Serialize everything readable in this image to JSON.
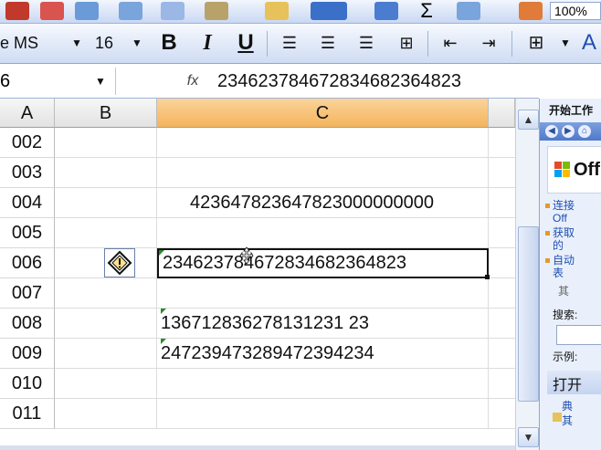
{
  "toolbar_top": {
    "zoom": "100%",
    "icons": [
      "print-icon",
      "preview-icon",
      "spell-icon",
      "research-icon",
      "copy-icon",
      "paste-icon",
      "format-painter-icon",
      "undo-icon",
      "hyperlink-icon",
      "sum-icon",
      "sort-icon",
      "chart-icon"
    ]
  },
  "format_toolbar": {
    "font_name": "e MS",
    "font_size": "16",
    "bold": "B",
    "italic": "I",
    "underline": "U",
    "font_color_letter": "A"
  },
  "formula_bar": {
    "name_box": "6",
    "fx": "fx",
    "content": "234623784672834682364823"
  },
  "columns": [
    "A",
    "B",
    "C"
  ],
  "rows": [
    {
      "label": "002",
      "c": ""
    },
    {
      "label": "003",
      "c": ""
    },
    {
      "label": "004",
      "c": "423647823647823000000000"
    },
    {
      "label": "005",
      "c": ""
    },
    {
      "label": "006",
      "c": "234623784672834682364823"
    },
    {
      "label": "007",
      "c": ""
    },
    {
      "label": "008",
      "c": "136712836278131231 23"
    },
    {
      "label": "009",
      "c": "247239473289472394234"
    },
    {
      "label": "010",
      "c": ""
    },
    {
      "label": "011",
      "c": ""
    }
  ],
  "task_pane": {
    "title": "开始工作",
    "office_text": "Off",
    "items": [
      "连接",
      "Off",
      "获取",
      "的",
      "自动",
      "表",
      "其"
    ],
    "search_label": "搜索:",
    "example_label": "示例:",
    "open_section": "打开",
    "open_items": [
      "典",
      "其"
    ]
  },
  "colors": {
    "selected_header": "#f4b45c",
    "accent": "#4f78c8"
  }
}
